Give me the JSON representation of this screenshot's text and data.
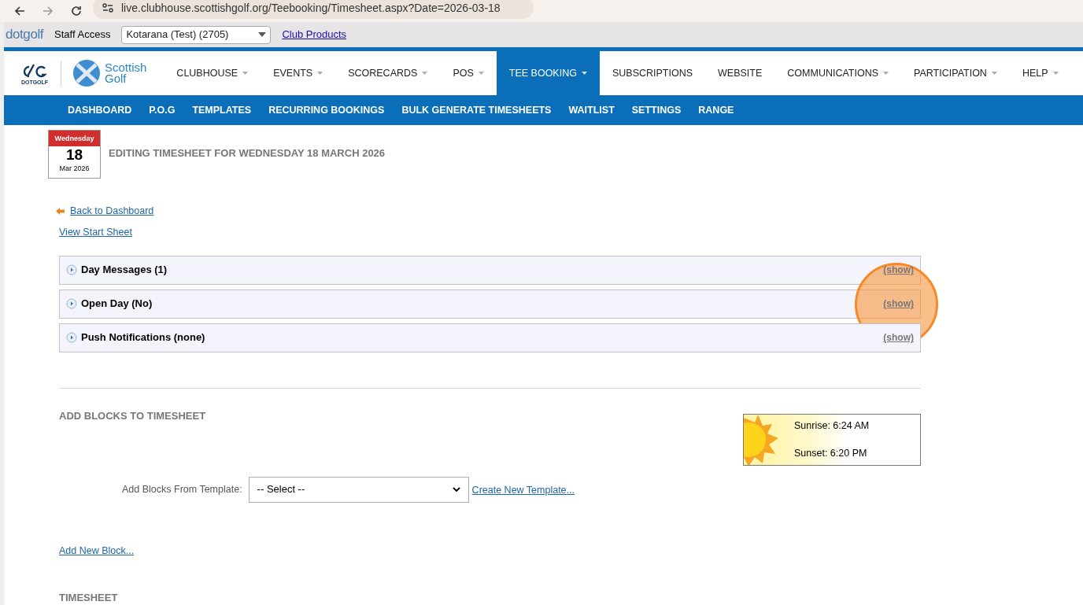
{
  "browser": {
    "url": "live.clubhouse.scottishgolf.org/Teebooking/Timesheet.aspx?Date=2026-03-18"
  },
  "staff_bar": {
    "logo": "dotgolf",
    "label": "Staff Access",
    "club": "Kotarana (Test) (2705)",
    "link": "Club Products"
  },
  "brand": {
    "dotgolf_logo": "DOTGOLF",
    "scottish_golf": [
      "Scottish",
      "Golf"
    ]
  },
  "main_nav": [
    {
      "label": "CLUBHOUSE",
      "dropdown": true,
      "selected": false
    },
    {
      "label": "EVENTS",
      "dropdown": true,
      "selected": false
    },
    {
      "label": "SCORECARDS",
      "dropdown": true,
      "selected": false
    },
    {
      "label": "POS",
      "dropdown": true,
      "selected": false
    },
    {
      "label": "TEE BOOKING",
      "dropdown": true,
      "selected": true
    },
    {
      "label": "SUBSCRIPTIONS",
      "dropdown": false,
      "selected": false
    },
    {
      "label": "WEBSITE",
      "dropdown": false,
      "selected": false
    },
    {
      "label": "COMMUNICATIONS",
      "dropdown": true,
      "selected": false
    },
    {
      "label": "PARTICIPATION",
      "dropdown": true,
      "selected": false
    },
    {
      "label": "HELP",
      "dropdown": true,
      "selected": false
    }
  ],
  "sub_nav": [
    "DASHBOARD",
    "P.O.G",
    "TEMPLATES",
    "RECURRING BOOKINGS",
    "BULK GENERATE TIMESHEETS",
    "WAITLIST",
    "SETTINGS",
    "RANGE"
  ],
  "calendar": {
    "weekday": "Wednesday",
    "day": "18",
    "month_year": "Mar 2026"
  },
  "title": "EDITING TIMESHEET FOR WEDNESDAY 18 MARCH 2026",
  "links": {
    "back": "Back to Dashboard",
    "start_sheet": "View Start Sheet"
  },
  "panels": [
    {
      "title": "Day Messages (1)",
      "toggle": "(show)",
      "highlighted": false
    },
    {
      "title": "Open Day (No)",
      "toggle": "(show)",
      "highlighted": true
    },
    {
      "title": "Push Notifications (none)",
      "toggle": "(show)",
      "highlighted": false
    }
  ],
  "add_blocks": {
    "heading": "ADD BLOCKS TO TIMESHEET",
    "template_label": "Add Blocks From Template:",
    "template_select": "-- Select --",
    "create_link": "Create New Template...",
    "add_new_link": "Add New Block..."
  },
  "sun": {
    "sunrise": "Sunrise: 6:24 AM",
    "sunset": "Sunset: 6:20 PM"
  },
  "timesheet_heading": "TIMESHEET"
}
